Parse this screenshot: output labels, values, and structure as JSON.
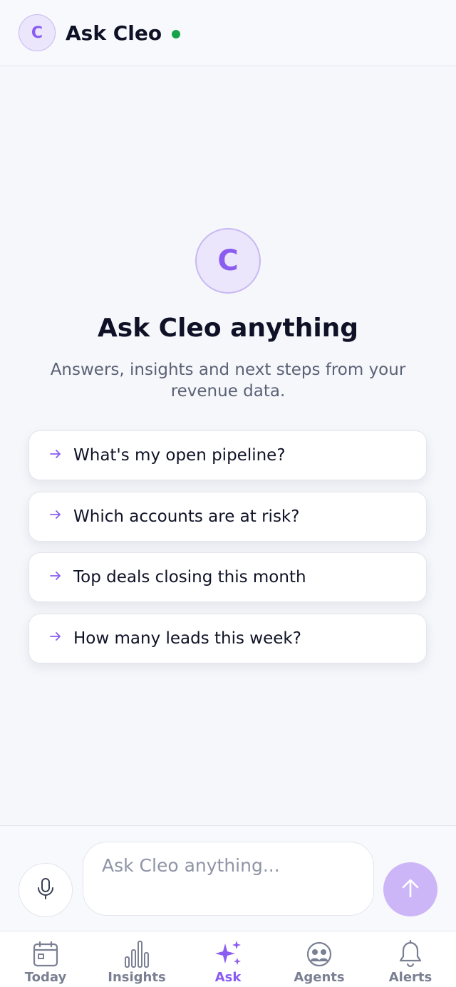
{
  "header": {
    "avatar_letter": "C",
    "title": "Ask Cleo",
    "status_color": "#16a34a"
  },
  "hero": {
    "avatar_letter": "C",
    "title": "Ask Cleo anything",
    "subtitle": "Answers, insights and next steps from your revenue data."
  },
  "suggestions": [
    {
      "label": "What's my open pipeline?",
      "icon": "arrow-right-icon"
    },
    {
      "label": "Which accounts are at risk?",
      "icon": "arrow-right-icon"
    },
    {
      "label": "Top deals closing this month",
      "icon": "arrow-right-icon"
    },
    {
      "label": "How many leads this week?",
      "icon": "arrow-right-icon"
    }
  ],
  "composer": {
    "placeholder": "Ask Cleo anything...",
    "mic_icon": "microphone-icon",
    "send_icon": "arrow-up-icon"
  },
  "nav": {
    "active": "Ask",
    "items": [
      {
        "label": "Today",
        "icon": "calendar-icon"
      },
      {
        "label": "Insights",
        "icon": "bar-chart-icon"
      },
      {
        "label": "Ask",
        "icon": "sparkles-icon"
      },
      {
        "label": "Agents",
        "icon": "agents-icon"
      },
      {
        "label": "Alerts",
        "icon": "bell-icon"
      }
    ]
  },
  "colors": {
    "accent": "#8a5cf0",
    "accent_light": "#ebe6fb",
    "send_button": "#cdb6f8",
    "text_primary": "#0f1226",
    "text_secondary": "#5b6275",
    "background": "#f6f7fb"
  }
}
